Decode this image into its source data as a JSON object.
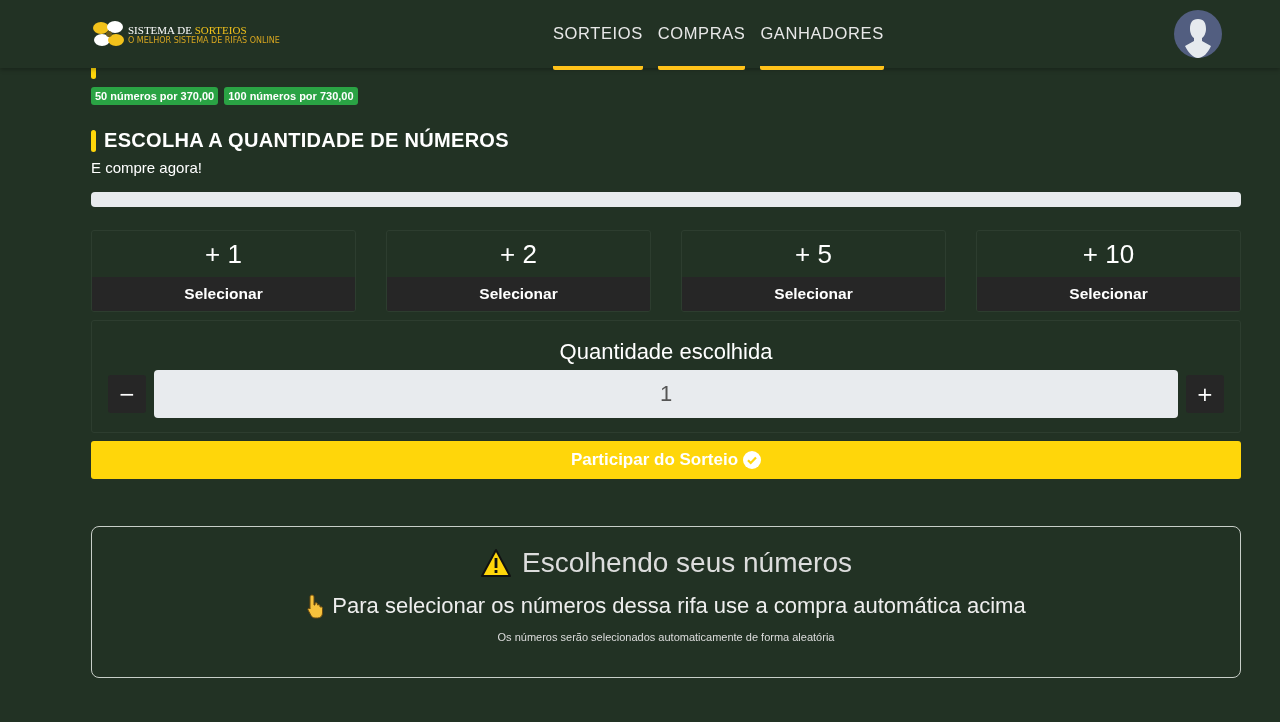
{
  "logo": {
    "title_start": "SISTEMA DE ",
    "title_end": "SORTEIOS",
    "tagline": "O MELHOR SISTEMA DE RIFAS ONLINE"
  },
  "nav": [
    {
      "label": "SORTEIOS"
    },
    {
      "label": "COMPRAS"
    },
    {
      "label": "GANHADORES"
    }
  ],
  "promo": {
    "badges": [
      "50 números por 370,00",
      "100 números por 730,00"
    ]
  },
  "choose": {
    "title": "ESCOLHA A QUANTIDADE DE NÚMEROS",
    "subtitle": "E compre agora!",
    "progress": {
      "level": 0
    }
  },
  "options": [
    {
      "amount": "+ 1",
      "button": "Selecionar"
    },
    {
      "amount": "+ 2",
      "button": "Selecionar"
    },
    {
      "amount": "+ 5",
      "button": "Selecionar"
    },
    {
      "amount": "+ 10",
      "button": "Selecionar"
    }
  ],
  "quantity": {
    "label": "Quantidade escolhida",
    "minus": "−",
    "value": "1",
    "plus": "+"
  },
  "participate": {
    "label": "Participar do Sorteio"
  },
  "info": {
    "title": "Escolhendo seus números",
    "message": "Para selecionar os números dessa rifa use a compra automática acima",
    "note": "Os números serão selecionados automaticamente de forma aleatória"
  }
}
